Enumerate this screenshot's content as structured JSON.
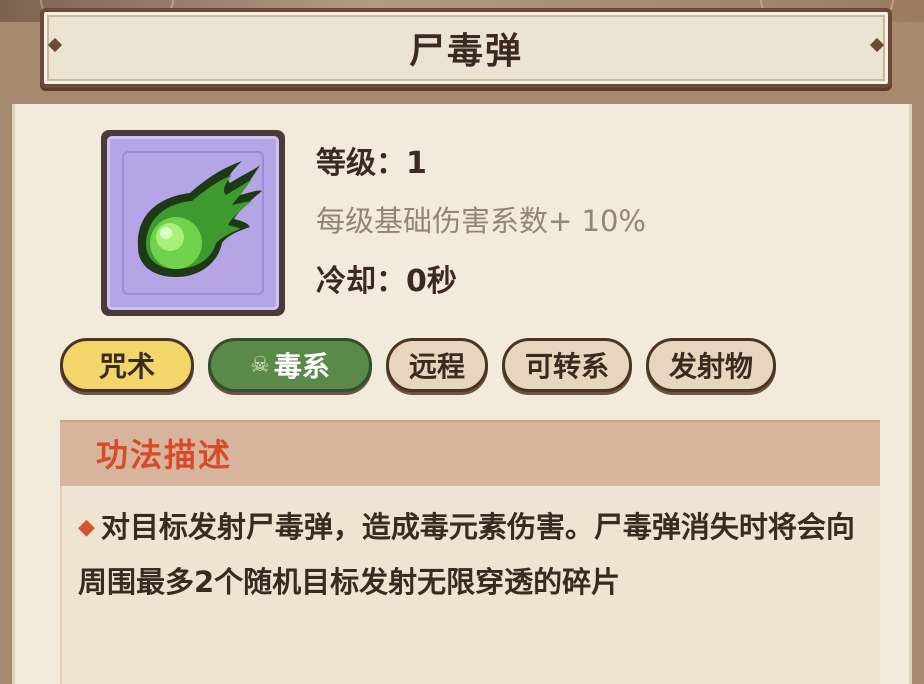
{
  "title": "尸毒弹",
  "skill": {
    "icon": "green-poison-fireball-icon",
    "level_label": "等级：",
    "level_value": "1",
    "scaling_text": "每级基础伤害系数+ 10%",
    "cooldown_label": "冷却：",
    "cooldown_value": "0秒"
  },
  "tags": [
    {
      "label": "咒术",
      "color": "#f3d66a"
    },
    {
      "label": "毒系",
      "color": "#5a8a4a",
      "icon": "skull-icon"
    },
    {
      "label": "远程",
      "color": "#e8d5bf"
    },
    {
      "label": "可转系",
      "color": "#e8d5bf"
    },
    {
      "label": "发射物",
      "color": "#e8d5bf"
    }
  ],
  "description": {
    "header": "功法描述",
    "bullet_icon": "diamond-bullet-icon",
    "text": "对目标发射尸毒弹，造成毒元素伤害。尸毒弹消失时将会向周围最多2个随机目标发射无限穿透的碎片"
  },
  "colors": {
    "title_border": "#6d4a38",
    "header_text": "#d84a2a",
    "icon_background": "#b6a5e6"
  }
}
